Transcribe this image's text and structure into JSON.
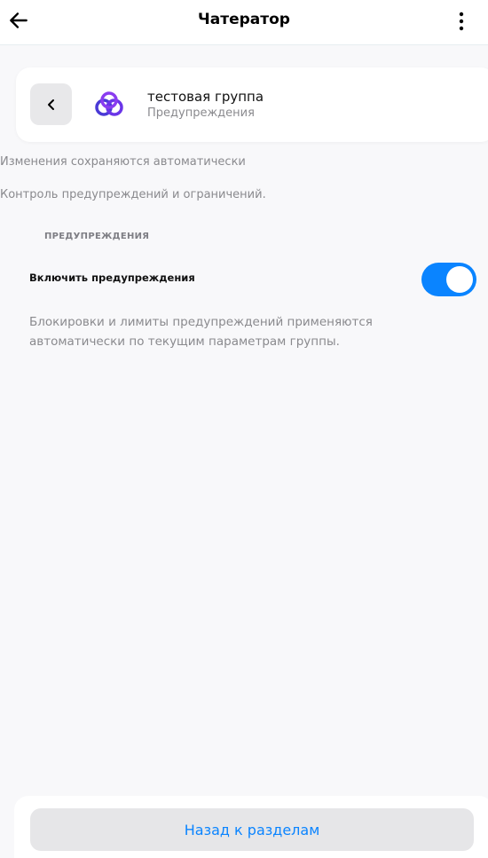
{
  "app_bar": {
    "title": "Чатератор",
    "back_icon": "arrow-left-icon",
    "menu_icon": "more-vertical-icon"
  },
  "group_card": {
    "name": "тестовая группа",
    "subtitle": "Предупреждения",
    "back_icon": "chevron-left-icon",
    "logo_icon": "interlocked-rings-logo",
    "logo_color": "#6a35e8"
  },
  "info": {
    "autosave": "Изменения сохраняются автоматически",
    "description": "Контроль предупреждений и ограничений."
  },
  "warnings_section": {
    "header": "ПРЕДУПРЕЖДЕНИЯ",
    "toggle_label": "Включить предупреждения",
    "toggle_on": true,
    "toggle_color": "#0a84ff",
    "footnote": "Блокировки и лимиты предупреждений применяются автоматически по текущим параметрам группы."
  },
  "footer": {
    "back_to_sections": "Назад к разделам"
  }
}
